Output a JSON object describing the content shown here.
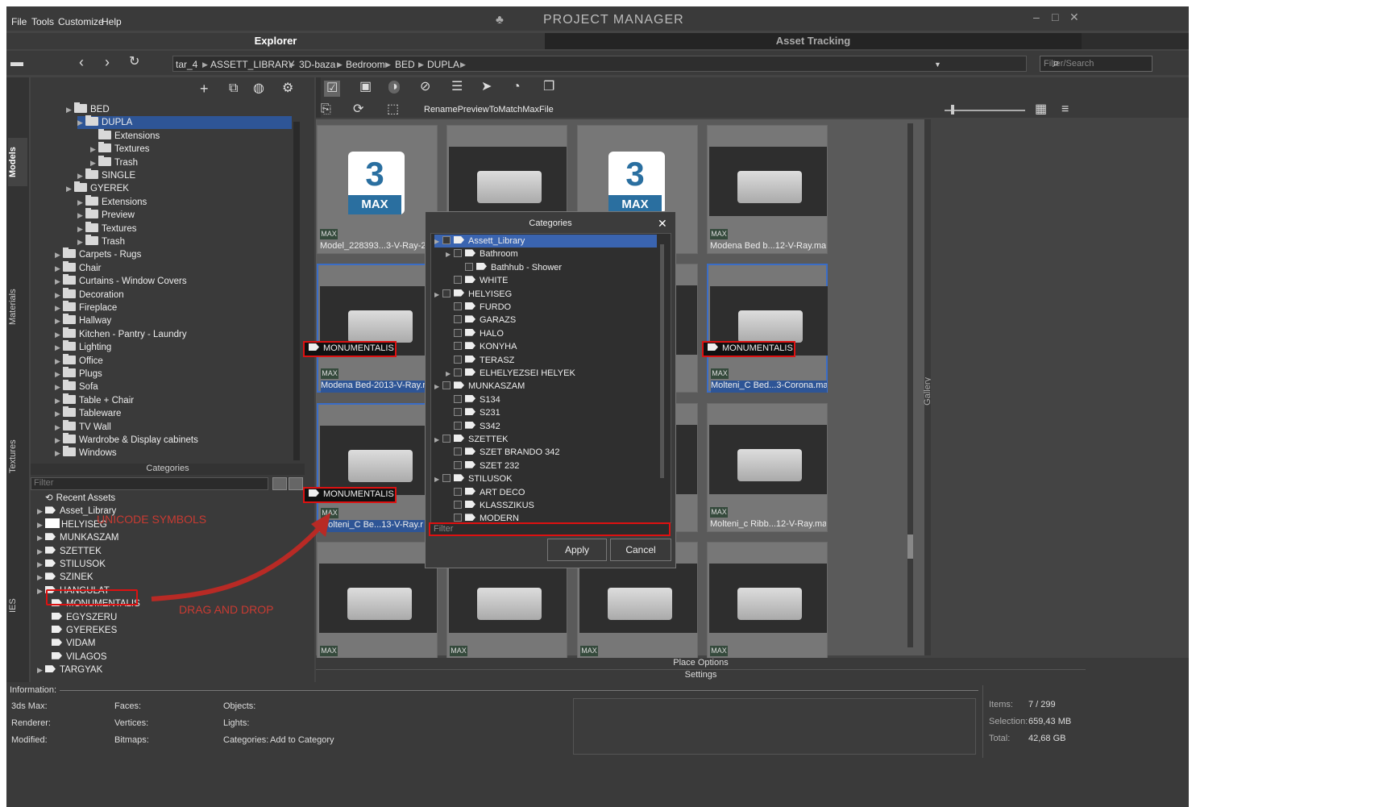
{
  "menu": [
    "File",
    "Tools",
    "Customize",
    "Help"
  ],
  "app_title": "PROJECT MANAGER",
  "tabs": {
    "explorer": "Explorer",
    "asset_tracking": "Asset Tracking"
  },
  "breadcrumb": [
    "tar_4",
    "ASSETT_LIBRARY",
    "3D-baza",
    "Bedroom",
    "BED",
    "DUPLA"
  ],
  "search_placeholder": "Filter/Search",
  "side_tabs": [
    "Models",
    "Materials",
    "Textures",
    "IES"
  ],
  "tree": [
    {
      "label": "BED",
      "indent": 0
    },
    {
      "label": "DUPLA",
      "indent": 1,
      "selected": true
    },
    {
      "label": "Extensions",
      "indent": 2
    },
    {
      "label": "Textures",
      "indent": 2
    },
    {
      "label": "Trash",
      "indent": 2
    },
    {
      "label": "SINGLE",
      "indent": 1
    },
    {
      "label": "GYEREK",
      "indent": 0
    },
    {
      "label": "Extensions",
      "indent": 1
    },
    {
      "label": "Preview",
      "indent": 1
    },
    {
      "label": "Textures",
      "indent": 1
    },
    {
      "label": "Trash",
      "indent": 1
    },
    {
      "label": "Carpets - Rugs",
      "indent": -1
    },
    {
      "label": "Chair",
      "indent": -1
    },
    {
      "label": "Curtains - Window Covers",
      "indent": -1
    },
    {
      "label": "Decoration",
      "indent": -1
    },
    {
      "label": "Fireplace",
      "indent": -1
    },
    {
      "label": "Hallway",
      "indent": -1
    },
    {
      "label": "Kitchen - Pantry - Laundry",
      "indent": -1
    },
    {
      "label": "Lighting",
      "indent": -1
    },
    {
      "label": "Office",
      "indent": -1
    },
    {
      "label": "Plugs",
      "indent": -1
    },
    {
      "label": "Sofa",
      "indent": -1
    },
    {
      "label": "Table + Chair",
      "indent": -1
    },
    {
      "label": "Tableware",
      "indent": -1
    },
    {
      "label": "TV Wall",
      "indent": -1
    },
    {
      "label": "Wardrobe & Display cabinets",
      "indent": -1
    },
    {
      "label": "Windows",
      "indent": -1
    }
  ],
  "categories_header": "Categories",
  "filter_placeholder": "Filter",
  "categories": [
    {
      "label": "Recent Assets",
      "indent": 0
    },
    {
      "label": "Asset_Library",
      "indent": 0
    },
    {
      "label": "HELYISEG",
      "indent": 0
    },
    {
      "label": "MUNKASZAM",
      "indent": 0
    },
    {
      "label": "SZETTEK",
      "indent": 0
    },
    {
      "label": "STILUSOK",
      "indent": 0
    },
    {
      "label": "SZINEK",
      "indent": 0
    },
    {
      "label": "HANGULAT",
      "indent": 0
    },
    {
      "label": "MONUMENTALIS",
      "indent": 1
    },
    {
      "label": "EGYSZERU",
      "indent": 1
    },
    {
      "label": "GYEREKES",
      "indent": 1
    },
    {
      "label": "VIDAM",
      "indent": 1
    },
    {
      "label": "VILAGOS",
      "indent": 1
    },
    {
      "label": "TARGYAK",
      "indent": 0
    }
  ],
  "annotations": {
    "unicode": "UNICODE SYMBOLS",
    "drag": "DRAG AND DROP"
  },
  "gallery_toolbar_text": "RenamePreviewToMatchMaxFile",
  "cards": [
    {
      "caption": "Model_228393...3-V-Ray-2",
      "type": "max"
    },
    {
      "caption": "",
      "type": "bed"
    },
    {
      "caption": "2.max",
      "type": "max"
    },
    {
      "caption": "Modena Bed b...12-V-Ray.max",
      "type": "bed"
    },
    {
      "caption": "Modena Bed-2013-V-Ray.r",
      "type": "bed",
      "selected": true,
      "tag": true
    },
    {
      "caption": "",
      "type": "bed"
    },
    {
      "caption": "y.max",
      "type": "bed"
    },
    {
      "caption": "Molteni_C  Bed...3-Corona.max",
      "type": "bed",
      "selected": true,
      "tag": true
    },
    {
      "caption": "Molteni_C  Be...13-V-Ray.r",
      "type": "bed",
      "selected": true,
      "tag": true
    },
    {
      "caption": "",
      "type": "bed"
    },
    {
      "caption": "y.max",
      "type": "bed"
    },
    {
      "caption": "Molteni_c Ribb...12-V-Ray.max",
      "type": "bed"
    },
    {
      "caption": "",
      "type": "bed"
    },
    {
      "caption": "",
      "type": "bed"
    },
    {
      "caption": "",
      "type": "bed"
    },
    {
      "caption": "",
      "type": "bed"
    }
  ],
  "max_badge": "MAX",
  "max_logo": {
    "num": "3",
    "text": "MAX"
  },
  "tag_label": "MONUMENTALIS",
  "dialog": {
    "title": "Categories",
    "rows": [
      {
        "label": "Assett_Library",
        "indent": 0,
        "selected": true
      },
      {
        "label": "Bathroom",
        "indent": 1
      },
      {
        "label": "Bathhub - Shower",
        "indent": 2
      },
      {
        "label": "WHITE",
        "indent": 1
      },
      {
        "label": "HELYISEG",
        "indent": 0
      },
      {
        "label": "FURDO",
        "indent": 1
      },
      {
        "label": "GARAZS",
        "indent": 1
      },
      {
        "label": "HALO",
        "indent": 1
      },
      {
        "label": "KONYHA",
        "indent": 1
      },
      {
        "label": "TERASZ",
        "indent": 1
      },
      {
        "label": "ELHELYEZSEI HELYEK",
        "indent": 1
      },
      {
        "label": "MUNKASZAM",
        "indent": 0
      },
      {
        "label": "S134",
        "indent": 1
      },
      {
        "label": "S231",
        "indent": 1
      },
      {
        "label": "S342",
        "indent": 1
      },
      {
        "label": "SZETTEK",
        "indent": 0
      },
      {
        "label": "SZET BRANDO 342",
        "indent": 1
      },
      {
        "label": "SZET 232",
        "indent": 1
      },
      {
        "label": "STILUSOK",
        "indent": 0
      },
      {
        "label": "ART DECO",
        "indent": 1
      },
      {
        "label": "KLASSZIKUS",
        "indent": 1
      },
      {
        "label": "MODERN",
        "indent": 1
      }
    ],
    "filter_placeholder": "Filter",
    "apply": "Apply",
    "cancel": "Cancel"
  },
  "gallery_tab": "Gallery",
  "place_options": "Place Options",
  "settings": "Settings",
  "info": {
    "header": "Information:",
    "labels": {
      "max": "3ds Max:",
      "renderer": "Renderer:",
      "modified": "Modified:",
      "faces": "Faces:",
      "vertices": "Vertices:",
      "bitmaps": "Bitmaps:",
      "objects": "Objects:",
      "lights": "Lights:",
      "categories": "Categories:"
    },
    "add_category": "Add to Category",
    "items_label": "Items:",
    "items": "7 / 299",
    "selection_label": "Selection:",
    "selection": "659,43 MB",
    "total_label": "Total:",
    "total": "42,68 GB"
  }
}
